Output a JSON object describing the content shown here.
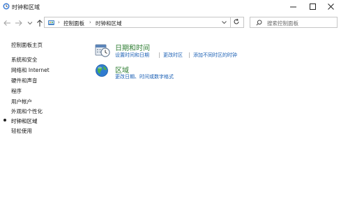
{
  "window": {
    "title": "时钟和区域"
  },
  "address_bar": {
    "crumbs": [
      "控制面板",
      "时钟和区域"
    ]
  },
  "search": {
    "placeholder": "搜索控制面板"
  },
  "sidebar": {
    "home": "控制面板主页",
    "items": [
      {
        "label": "系统和安全"
      },
      {
        "label": "网络和 Internet"
      },
      {
        "label": "硬件和声音"
      },
      {
        "label": "程序"
      },
      {
        "label": "用户帐户"
      },
      {
        "label": "外观和个性化"
      },
      {
        "label": "时钟和区域",
        "current": true
      },
      {
        "label": "轻松使用"
      }
    ]
  },
  "main": {
    "categories": [
      {
        "title": "日期和时间",
        "icon": "date-time-icon",
        "links": [
          "设置时间和日期",
          "更改时区",
          "添加不同时区的时钟"
        ]
      },
      {
        "title": "区域",
        "icon": "globe-icon",
        "links": [
          "更改日期、时间或数字格式"
        ]
      }
    ]
  },
  "colors": {
    "category_title": "#2e7d32",
    "link": "#1a5fb4"
  }
}
